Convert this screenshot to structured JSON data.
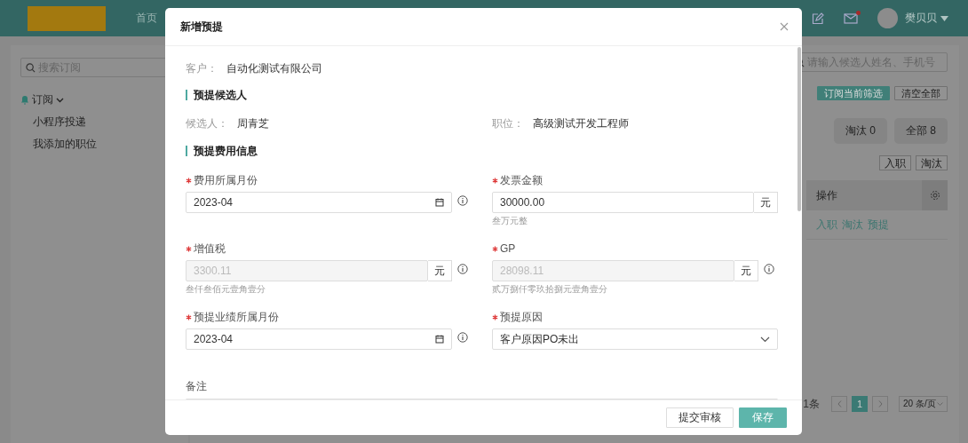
{
  "header": {
    "nav_item": "首页",
    "username": "樊贝贝",
    "mail_unread": true
  },
  "sidebar": {
    "search": {
      "placeholder": "搜索订阅"
    },
    "group": {
      "label": "订阅",
      "expanded": true,
      "items": [
        {
          "label": "小程序投递"
        },
        {
          "label": "我添加的职位"
        }
      ]
    }
  },
  "main": {
    "search": {
      "placeholder": "请输入候选人姓名、手机号"
    },
    "filter_buttons": [
      {
        "label": "订阅当前筛选",
        "kind": "primary"
      },
      {
        "label": "清空全部",
        "kind": "default"
      }
    ],
    "stat_tabs": [
      {
        "label": "淘汰 0",
        "selected": false
      },
      {
        "label": "全部 8",
        "selected": false
      }
    ],
    "action_buttons": [
      "入职",
      "淘汰"
    ],
    "table": {
      "columns": [
        "操作"
      ],
      "rows": [
        {
          "actions": [
            "入职",
            "淘汰",
            "预提"
          ]
        }
      ]
    },
    "pagination": {
      "total": "1条",
      "pages": [
        {
          "label": "1",
          "selected": true
        }
      ],
      "page_size": "20 条/页"
    }
  },
  "modal": {
    "title": "新增预提",
    "customer": {
      "label": "客户：",
      "value": "自动化测试有限公司"
    },
    "candidate_section": {
      "title": "预提候选人",
      "fields": [
        {
          "label": "候选人：",
          "value": "周青芝"
        },
        {
          "label": "职位：",
          "value": "高级测试开发工程师"
        }
      ]
    },
    "cost_section": {
      "title": "预提费用信息",
      "fields": [
        {
          "label": "费用所属月份",
          "required": true,
          "kind": "date",
          "value": "2023-04",
          "disabled": false,
          "info": true
        },
        {
          "label": "发票金额",
          "required": true,
          "kind": "amount",
          "value": "30000.00",
          "unit": "元",
          "disabled": false,
          "info": false,
          "hint": "叁万元整"
        },
        {
          "label": "增值税",
          "required": true,
          "kind": "amount",
          "value": "3300.11",
          "unit": "元",
          "disabled": true,
          "info": true,
          "hint": "叁仟叁佰元壹角壹分"
        },
        {
          "label": "GP",
          "required": true,
          "kind": "amount",
          "value": "28098.11",
          "unit": "元",
          "disabled": true,
          "info": true,
          "hint": "贰万捌仟零玖拾捌元壹角壹分"
        },
        {
          "label": "预提业绩所属月份",
          "required": true,
          "kind": "date",
          "value": "2023-04",
          "disabled": false,
          "info": true
        },
        {
          "label": "预提原因",
          "required": true,
          "kind": "select",
          "value": "客户原因PO未出",
          "disabled": false,
          "info": false
        }
      ],
      "note": {
        "label": "备注"
      }
    },
    "buttons": [
      {
        "label": "提交审核",
        "kind": "default"
      },
      {
        "label": "保存",
        "kind": "primary"
      }
    ]
  }
}
